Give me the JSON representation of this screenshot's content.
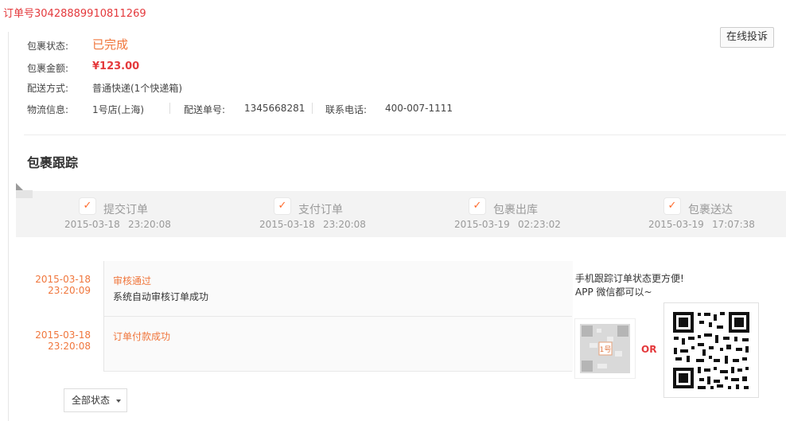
{
  "order": {
    "number_text": "订单号304288899108112​69"
  },
  "package_info": {
    "status_label": "包裹状态:",
    "status_value": "已完成",
    "amount_label": "包裹金额:",
    "amount_value": "¥123.00",
    "delivery_label": "配送方式:",
    "delivery_value": "普通快递(1个快递箱)",
    "logistics_label": "物流信息:",
    "store_value": "1号店(上海)",
    "waybill_label": "配送单号:",
    "waybill_value": "1345668281",
    "phone_label": "联系电话:",
    "phone_value": "400-007-1111"
  },
  "complaint_button": "在线投诉",
  "tracking": {
    "title": "包裹跟踪",
    "steps": [
      {
        "label": "提交订单",
        "date": "2015-03-18",
        "time": "23:20:08"
      },
      {
        "label": "支付订单",
        "date": "2015-03-18",
        "time": "23:20:08"
      },
      {
        "label": "包裹出库",
        "date": "2015-03-19",
        "time": "02:23:02"
      },
      {
        "label": "包裹送达",
        "date": "2015-03-19",
        "time": "17:07:38"
      }
    ],
    "log": [
      {
        "date": "2015-03-18",
        "time": "23:20:09",
        "title": "审核通过",
        "desc": "系统自动审核订单成功"
      },
      {
        "date": "2015-03-18",
        "time": "23:20:08",
        "title": "订单付款成功",
        "desc": ""
      }
    ],
    "filter_label": "全部状态"
  },
  "mobile_promo": {
    "line1": "手机跟踪订单状态更方便!",
    "line2": "APP 微信都可以~",
    "or_text": "OR"
  },
  "colors": {
    "accent": "#f0763c",
    "price": "#e4393c"
  },
  "icons": {
    "step_check": "check-icon",
    "filter_caret": "caret-down-icon"
  }
}
